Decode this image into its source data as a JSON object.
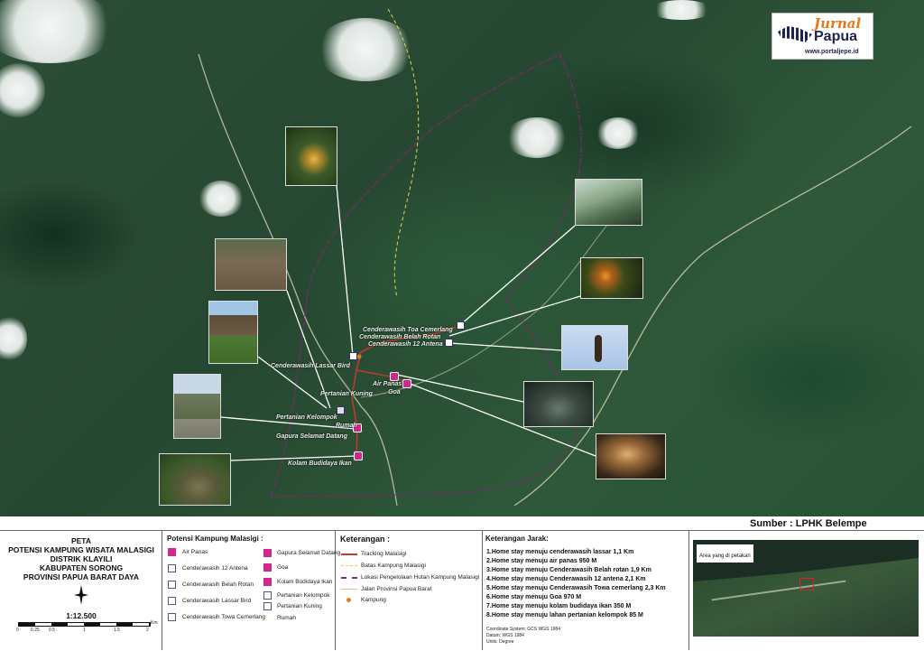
{
  "logo": {
    "script": "Jurnal",
    "name": "Papua",
    "url": "www.portaljepe.id"
  },
  "source": "Sumber : LPHK Belempe",
  "map_labels": {
    "cenderawasih_toa": "Cenderawasih Toa Cemerlang",
    "cenderawasih_belah": "Cenderawasih Belah Rotan",
    "cenderawasih_12": "Cenderawasih 12 Antena",
    "cenderawasih_lassar": "Cenderawasih Lassar Bird",
    "pertanian_kuning": "Pertanian Kuning",
    "air_panas": "Air Panas",
    "goa": "Goa",
    "pertanian_kelompok": "Pertanian Kelompok",
    "rumah": "Rumah",
    "gapura": "Gapura Selamat Datang",
    "kolam": "Kolam Budidaya Ikan"
  },
  "title_block": {
    "line1": "PETA",
    "line2": "POTENSI KAMPUNG WISATA MALASIGI",
    "line3": "DISTRIK KLAYILI",
    "line4": "KABUPATEN SORONG",
    "line5": "PROVINSI PAPUA BARAT DAYA",
    "scale": "1:12.500",
    "scalebar_ticks": [
      "0",
      "0.25",
      "0.5",
      "1",
      "1.5",
      "2"
    ],
    "scalebar_unit": "Km"
  },
  "potensi": {
    "header": "Potensi Kampung Malasigi :",
    "col1": [
      "Air Panas",
      "Cenderawasih 12 Antena",
      "Cenderawasih Belah Rotan",
      "Cenderawasih Lassar Bird",
      "Cenderawasih Towa Cemerlang"
    ],
    "col2": [
      "Gapura Selamat Datang",
      "Goa",
      "Kolam Budidaya Ikan",
      "Pertanian Kelompok",
      "Pertanian Kuning",
      "Rumah"
    ]
  },
  "keterangan": {
    "header": "Keterangan :",
    "items": [
      "Tracking Malasigi",
      "Batas Kampung Malasigi",
      "Lokasi Pengelolaan Hutan Kampung Malasigi",
      "Jalan Provinsi Papua Barat",
      "Kampung"
    ]
  },
  "jarak": {
    "header": "Keterangan Jarak:",
    "items": [
      "1.Home stay menuju cenderawasih lassar 1,1 Km",
      "2.Home stay menuju air panas 950 M",
      "3.Home stay menuju Cenderawasih Belah rotan 1,9 Km",
      "4.Home stay menuju Cenderawasih 12 antena 2,1 Km",
      "5.Home stay menuju Cenderawasih Towa cemerlang 2,3 Km",
      "6.Home stay menuju Goa 970 M",
      "7.Home stay menuju kolam budidaya ikan 350 M",
      "8.Home stay menuju lahan pertanian kelompok 85 M"
    ],
    "crs": [
      "Coordinate System: GCS WGS 1984",
      "Datum: WGS 1984",
      "Units: Degree"
    ]
  },
  "inset": {
    "label": "Area yang di petakan"
  },
  "colors": {
    "marker": "#d0288c",
    "tracking": "#c0392b",
    "batas": "#e6d24a",
    "hutan": "#7a2a6a",
    "jalan": "#d9d2b8"
  }
}
